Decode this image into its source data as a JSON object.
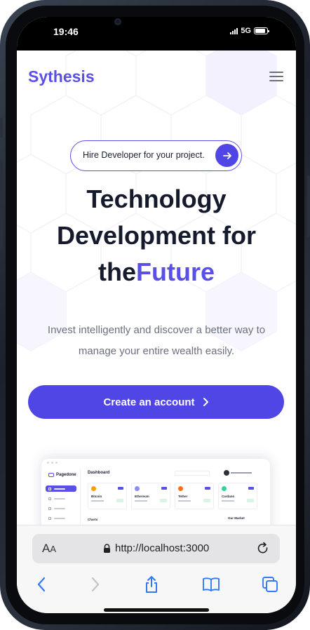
{
  "status_bar": {
    "time": "19:46",
    "network": "5G",
    "battery_percent": 90
  },
  "site": {
    "brand": "Sythesis",
    "hire_pill_text": "Hire Developer for your project.",
    "headline_line1": "Technology",
    "headline_line2": "Development for",
    "headline_prefix": "the",
    "headline_accent": "Future",
    "subtext": "Invest intelligently and discover a better way to manage your entire wealth easily.",
    "cta_label": "Create an account"
  },
  "dashboard_preview": {
    "logo": "Pagedone",
    "title": "Dashboard",
    "cards": [
      {
        "name": "Bitcoin",
        "color": "#f59e0b"
      },
      {
        "name": "Ethereum",
        "color": "#8b8ef5"
      },
      {
        "name": "Tether",
        "color": "#f97316"
      },
      {
        "name": "Cardano",
        "color": "#34d399"
      }
    ],
    "chart_label": "Charts",
    "market_label": "Our Market"
  },
  "browser": {
    "text_size_big": "A",
    "text_size_small": "A",
    "url": "http://localhost:3000"
  },
  "colors": {
    "accent": "#5b50e6",
    "cta": "#4f46e5",
    "heading": "#151a2c"
  }
}
